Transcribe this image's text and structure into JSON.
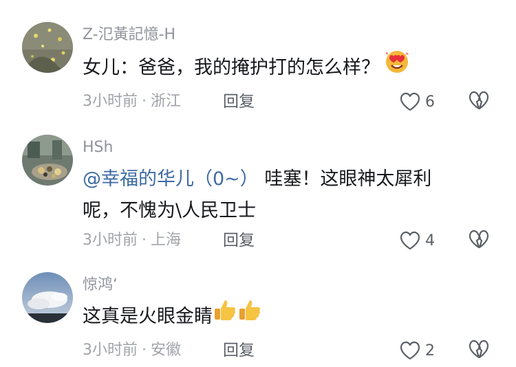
{
  "comments": [
    {
      "username": "Z-氾黃記憶-H",
      "text": "女儿：爸爸，我的掩护打的怎么样？",
      "emoji_after": "heart-eyes-emoji",
      "time": "3小时前",
      "separator": "·",
      "location": "浙江",
      "reply_label": "回复",
      "like_count": "6"
    },
    {
      "username": "HSh",
      "mention": "@幸福的华儿（0~）",
      "text_line1": " 哇塞！这眼神太犀利",
      "text_line2": "呢，不愧为\\人民卫士",
      "time": "3小时前",
      "separator": "·",
      "location": "上海",
      "reply_label": "回复",
      "like_count": "4"
    },
    {
      "username": "惊鸿‘",
      "text": "这真是火眼金睛",
      "emoji_after": "thumbs-up-emoji",
      "time": "3小时前",
      "separator": "·",
      "location": "安徽",
      "reply_label": "回复",
      "like_count": "2"
    }
  ],
  "colors": {
    "username": "#8f939b",
    "text": "#17191d",
    "mention": "#3d6aa3",
    "meta": "#a0a3a9",
    "icon": "#5b5f66"
  }
}
